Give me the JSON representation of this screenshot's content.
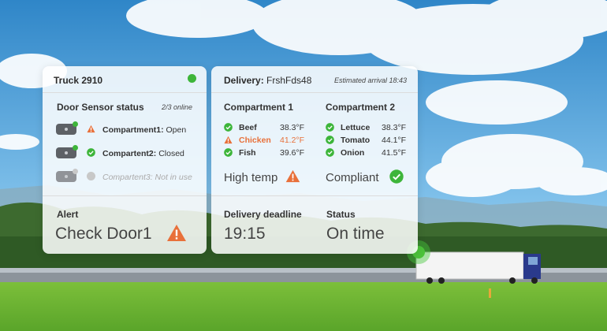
{
  "colors": {
    "ok": "#3db53a",
    "warning": "#e8703a",
    "inactive": "#c8c8c8"
  },
  "truck": {
    "title": "Truck 2910",
    "status_icon": "online-dot-icon",
    "door_sensor": {
      "heading": "Door Sensor status",
      "online_count": "2/3 online",
      "rows": [
        {
          "icon": "warning-icon",
          "label": "Compartment1:",
          "value": "Open"
        },
        {
          "icon": "check-circle-icon",
          "label": "Compartent2:",
          "value": "Closed"
        },
        {
          "icon": "inactive-dot-icon",
          "label": "Compartent3:",
          "value": "Not in use"
        }
      ]
    },
    "alert": {
      "heading": "Alert",
      "text": "Check Door1"
    }
  },
  "delivery": {
    "label": "Delivery:",
    "id": "FrshFds48",
    "eta": "Estimated arrival 18:43",
    "compartments": [
      {
        "title": "Compartment 1",
        "items": [
          {
            "name": "Beef",
            "temp": "38.3°F",
            "status": "ok"
          },
          {
            "name": "Chicken",
            "temp": "41.2°F",
            "status": "warning"
          },
          {
            "name": "Fish",
            "temp": "39.6°F",
            "status": "ok"
          }
        ],
        "summary": "High temp"
      },
      {
        "title": "Compartment 2",
        "items": [
          {
            "name": "Lettuce",
            "temp": "38.3°F",
            "status": "ok"
          },
          {
            "name": "Tomato",
            "temp": "44.1°F",
            "status": "ok"
          },
          {
            "name": "Onion",
            "temp": "41.5°F",
            "status": "ok"
          }
        ],
        "summary": "Compliant"
      }
    ],
    "deadline": {
      "heading": "Delivery deadline",
      "value": "19:15"
    },
    "status": {
      "heading": "Status",
      "value": "On time"
    }
  }
}
